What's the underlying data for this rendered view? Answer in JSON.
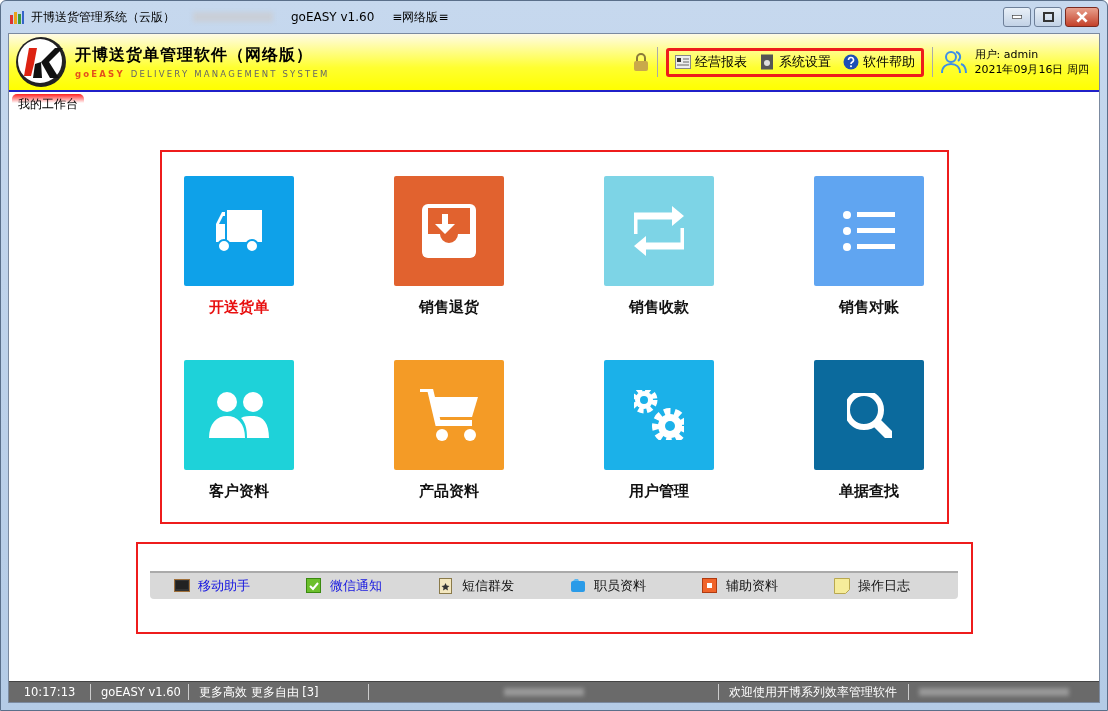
{
  "window": {
    "title": "开博送货管理系统（云版）",
    "version": "goEASY v1.60",
    "edition": "≡网络版≡"
  },
  "header": {
    "product_name": "开博送货单管理软件（网络版）",
    "tagline_brand": "goEASY",
    "tagline_rest": "DELIVERY MANAGEMENT SYSTEM",
    "menu": [
      {
        "label": "经营报表",
        "kind": "report"
      },
      {
        "label": "系统设置",
        "kind": "settings"
      },
      {
        "label": "软件帮助",
        "kind": "help"
      }
    ],
    "user": "用户: admin",
    "date": "2021年09月16日 周四"
  },
  "tabs": [
    {
      "label": "我的工作台",
      "selected": true
    }
  ],
  "tiles": [
    {
      "label": "开送货单",
      "kind": "truck",
      "color": "#0ea1e9",
      "selected": true
    },
    {
      "label": "销售退货",
      "kind": "return",
      "color": "#e1622f",
      "selected": false
    },
    {
      "label": "销售收款",
      "kind": "repeat",
      "color": "#7dd4e6",
      "selected": false
    },
    {
      "label": "销售对账",
      "kind": "list",
      "color": "#60a5f1",
      "selected": false
    },
    {
      "label": "客户资料",
      "kind": "users",
      "color": "#1ed2d9",
      "selected": false
    },
    {
      "label": "产品资料",
      "kind": "cart",
      "color": "#f49b26",
      "selected": false
    },
    {
      "label": "用户管理",
      "kind": "gears",
      "color": "#1bb1e9",
      "selected": false
    },
    {
      "label": "单据查找",
      "kind": "search",
      "color": "#0b6a9d",
      "selected": false
    }
  ],
  "shortcuts": [
    {
      "label": "移动助手",
      "kind": "monitor",
      "highlighted": true
    },
    {
      "label": "微信通知",
      "kind": "check",
      "highlighted": true
    },
    {
      "label": "短信群发",
      "kind": "star",
      "highlighted": false
    },
    {
      "label": "职员资料",
      "kind": "folder",
      "highlighted": false
    },
    {
      "label": "辅助资料",
      "kind": "square",
      "highlighted": false
    },
    {
      "label": "操作日志",
      "kind": "note",
      "highlighted": false
    }
  ],
  "status_bar": {
    "time": "10:17:13",
    "version": "goEASY v1.60",
    "slogan": "更多高效 更多自由 [3]",
    "welcome": "欢迎使用开博系列效率管理软件"
  }
}
